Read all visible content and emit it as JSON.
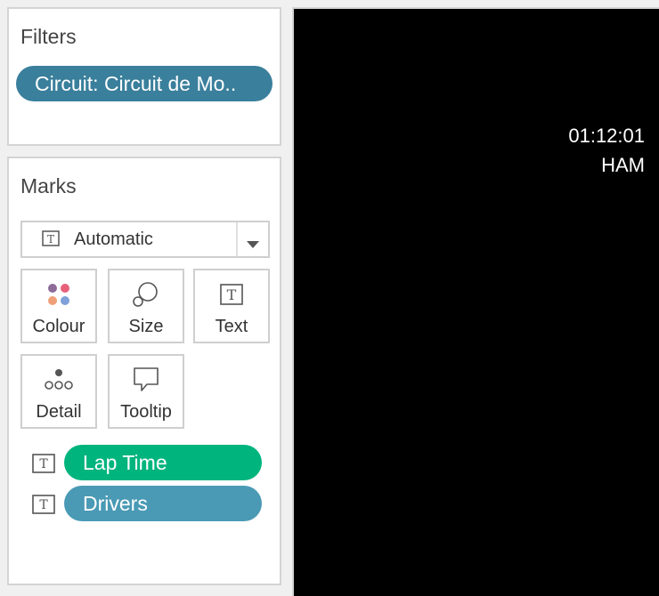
{
  "filters": {
    "title": "Filters",
    "pill_label": "Circuit: Circuit de Mo.."
  },
  "marks": {
    "title": "Marks",
    "mark_type": "Automatic",
    "buttons": {
      "colour": "Colour",
      "size": "Size",
      "text": "Text",
      "detail": "Detail",
      "tooltip": "Tooltip"
    },
    "fields": [
      {
        "label": "Lap Time",
        "color": "#00b47e",
        "icon": "text-icon"
      },
      {
        "label": "Drivers",
        "color": "#4a9ab5",
        "icon": "text-icon"
      }
    ]
  },
  "viz": {
    "lap_time": "01:12:01",
    "driver": "HAM",
    "background": "#000000"
  },
  "colors": {
    "filter_pill": "#3a7f9c",
    "dot_purple": "#8e6c9a",
    "dot_pink": "#e8607a",
    "dot_orange": "#f0a078",
    "dot_blue": "#7fa0d8"
  }
}
